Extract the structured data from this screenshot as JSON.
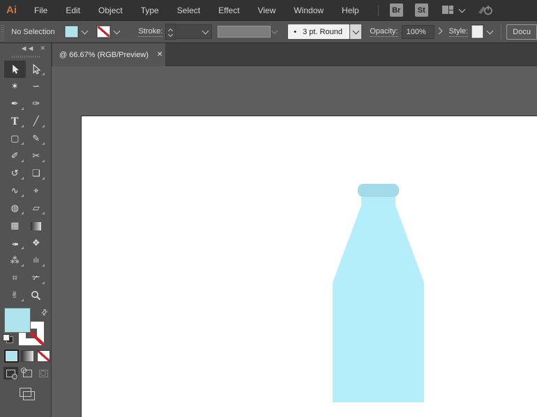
{
  "app": {
    "logo_label": "Ai"
  },
  "glyphs": {
    "close": "✕",
    "panel_collapse": "◄◄",
    "swap": "⇄",
    "brush_bullet": "•",
    "menu_separator": "|"
  },
  "menubar": {
    "items": [
      "File",
      "Edit",
      "Object",
      "Type",
      "Select",
      "Effect",
      "View",
      "Window",
      "Help"
    ],
    "bridge_label": "Br",
    "stock_label": "St"
  },
  "controlbar": {
    "selection_status": "No Selection",
    "stroke_label": "Stroke:",
    "brush_value": "3 pt. Round",
    "opacity_label": "Opacity:",
    "opacity_value": "100%",
    "style_label": "Style:",
    "document_setup_label": "Docu",
    "fill_color": "#ade4ee"
  },
  "document_tab": {
    "title": "@ 66.67% (RGB/Preview)"
  },
  "toolbar": {
    "fill_color": "#ade4ee",
    "tools": [
      {
        "name": "selection",
        "icon": "cursor-filled",
        "active": true
      },
      {
        "name": "direct-selection",
        "icon": "cursor-outline",
        "flyout": true
      },
      {
        "name": "magic-wand",
        "glyph": "✶"
      },
      {
        "name": "lasso",
        "glyph": "∽"
      },
      {
        "name": "pen",
        "glyph": "✒",
        "flyout": true
      },
      {
        "name": "curvature",
        "glyph": "✑"
      },
      {
        "name": "type",
        "glyph": "T",
        "serif": true,
        "flyout": true
      },
      {
        "name": "line-segment",
        "glyph": "╱",
        "flyout": true
      },
      {
        "name": "rectangle",
        "glyph": "▢",
        "flyout": true
      },
      {
        "name": "paintbrush",
        "glyph": "✎",
        "flyout": true
      },
      {
        "name": "shaper",
        "glyph": "✐",
        "flyout": true
      },
      {
        "name": "scissors",
        "glyph": "✂",
        "flyout": true
      },
      {
        "name": "rotate",
        "glyph": "↺",
        "flyout": true
      },
      {
        "name": "scale",
        "glyph": "❏",
        "flyout": true
      },
      {
        "name": "width",
        "glyph": "∿",
        "flyout": true
      },
      {
        "name": "puppet-warp",
        "glyph": "⌖"
      },
      {
        "name": "shape-builder",
        "glyph": "◍",
        "flyout": true
      },
      {
        "name": "perspective-grid",
        "glyph": "▱",
        "flyout": true
      },
      {
        "name": "mesh",
        "glyph": "▦"
      },
      {
        "name": "gradient",
        "icon": "gradient-box"
      },
      {
        "name": "eyedropper",
        "glyph": "✒",
        "rotate": true,
        "flyout": true
      },
      {
        "name": "blend",
        "glyph": "❖"
      },
      {
        "name": "symbol-sprayer",
        "glyph": "⁂",
        "flyout": true
      },
      {
        "name": "column-graph",
        "glyph": "ılı",
        "small": true,
        "flyout": true
      },
      {
        "name": "artboard",
        "glyph": "⌗"
      },
      {
        "name": "slice",
        "glyph": "✃",
        "flyout": true
      },
      {
        "name": "hand",
        "glyph": "✌",
        "flyout": true
      },
      {
        "name": "zoom",
        "icon": "magnifier"
      }
    ]
  },
  "canvas": {
    "artboard_color": "#ffffff",
    "bottle": {
      "body_color": "#b4eefa",
      "cap_color": "#a3dbe9"
    }
  }
}
